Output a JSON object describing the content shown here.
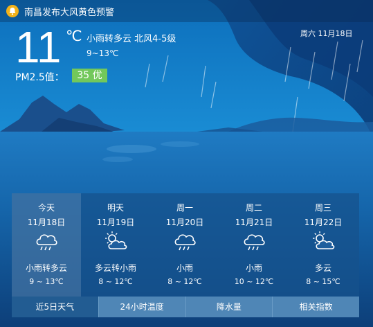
{
  "alert": {
    "text": "南昌发布大风黄色预警",
    "icon": "alert-bell-icon",
    "color": "#f2b21a"
  },
  "current": {
    "temperature": "11",
    "unit": "℃",
    "description": "小雨转多云 北风4-5级",
    "range": "9~13℃",
    "date": "周六 11月18日",
    "pm25_label": "PM2.5值：",
    "pm25_value": "35 优",
    "pm25_color": "#72c85b"
  },
  "forecast": [
    {
      "day": "今天",
      "date": "11月18日",
      "condition": "小雨转多云",
      "temp": "9 ~ 13℃",
      "icon": "rain-cloud-icon",
      "active": true
    },
    {
      "day": "明天",
      "date": "11月19日",
      "condition": "多云转小雨",
      "temp": "8 ~ 12℃",
      "icon": "partly-cloudy-icon",
      "active": false
    },
    {
      "day": "周一",
      "date": "11月20日",
      "condition": "小雨",
      "temp": "8 ~ 12℃",
      "icon": "rain-cloud-icon",
      "active": false
    },
    {
      "day": "周二",
      "date": "11月21日",
      "condition": "小雨",
      "temp": "10 ~ 12℃",
      "icon": "rain-cloud-icon",
      "active": false
    },
    {
      "day": "周三",
      "date": "11月22日",
      "condition": "多云",
      "temp": "8 ~ 15℃",
      "icon": "partly-cloudy-icon",
      "active": false
    }
  ],
  "tabs": [
    {
      "label": "近5日天气",
      "active": true
    },
    {
      "label": "24小时温度",
      "active": false
    },
    {
      "label": "降水量",
      "active": false
    },
    {
      "label": "相关指数",
      "active": false
    }
  ]
}
